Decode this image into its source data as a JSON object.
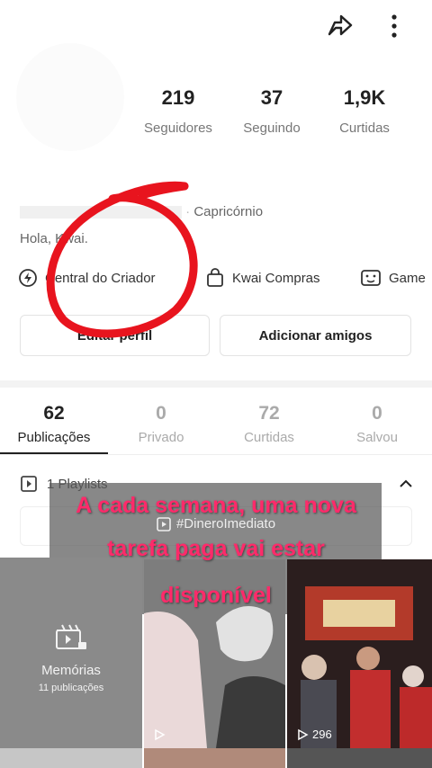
{
  "header": {
    "share_icon": "share-icon",
    "more_icon": "more-vertical-icon"
  },
  "stats": [
    {
      "value": "219",
      "label": "Seguidores"
    },
    {
      "value": "37",
      "label": "Seguindo"
    },
    {
      "value": "1,9K",
      "label": "Curtidas"
    }
  ],
  "profile": {
    "zodiac": "Capricórnio",
    "bio": "Hola, Kwai."
  },
  "chips": [
    {
      "label": "Central do Criador",
      "icon": "lightning-icon"
    },
    {
      "label": "Kwai Compras",
      "icon": "shopping-bag-icon"
    },
    {
      "label": "Game",
      "icon": "game-icon"
    }
  ],
  "buttons": {
    "edit": "Editar perfil",
    "add_friends": "Adicionar amigos"
  },
  "tabs": [
    {
      "count": "62",
      "label": "Publicações"
    },
    {
      "count": "0",
      "label": "Privado"
    },
    {
      "count": "72",
      "label": "Curtidas"
    },
    {
      "count": "0",
      "label": "Salvou"
    }
  ],
  "playlists": {
    "label": "1 Playlists",
    "tag": "#DineroImediato"
  },
  "caption": {
    "line1": "A cada semana, uma nova",
    "line2": "tarefa paga vai estar",
    "line3": "disponível"
  },
  "memories": {
    "title": "Memórias",
    "subtitle": "11 publicações"
  },
  "videos": [
    {
      "views": ""
    },
    {
      "views": "296"
    }
  ],
  "colors": {
    "annotation_red": "#e8141e",
    "caption_pink": "#ff2a6a"
  }
}
